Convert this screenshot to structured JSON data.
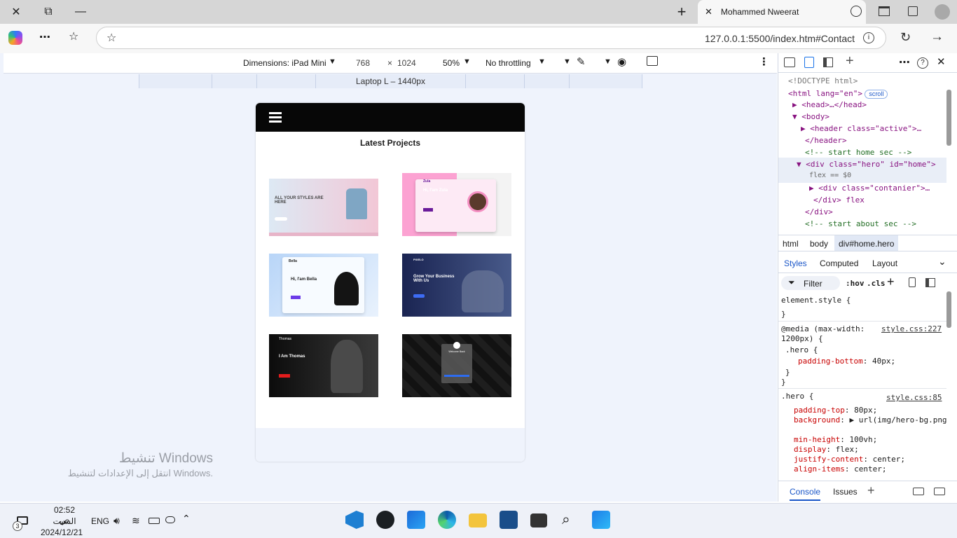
{
  "browser": {
    "tab_title": "Mohammed Nweerat",
    "url": "127.0.0.1:5500/index.htm#Contact",
    "icons": [
      "close-icon",
      "restore-icon",
      "minimize-icon",
      "plus-icon",
      "globe-icon",
      "tab-icon",
      "collections-icon",
      "profile-icon",
      "copilot-icon",
      "more-icon",
      "favorites-icon",
      "star-icon",
      "info-icon",
      "reload-icon",
      "forward-icon"
    ]
  },
  "device_toolbar": {
    "dimensions_label": "Dimensions: iPad Mini",
    "width": "768",
    "times": "×",
    "height": "1024",
    "zoom": "50%",
    "throttling": "No throttling"
  },
  "ruler": {
    "label": "Laptop L – 1440px"
  },
  "site": {
    "section_title": "Latest Projects",
    "projects": [
      {
        "heading": "ALL YOUR STYLES ARE HERE",
        "theme": "#d8e6f2"
      },
      {
        "heading": "Hi, I'am Zula",
        "brand": "Zula",
        "theme": "#fbb6dc"
      },
      {
        "heading": "Hi, I'am Bella",
        "brand": "Bella",
        "theme": "#cfe6fa"
      },
      {
        "heading": "Grow Your Business With Us",
        "brand": "PIXELO",
        "theme": "#1e2a5a"
      },
      {
        "heading": "I Am Thomas",
        "brand": "Thomas",
        "theme": "#1a1a1a"
      },
      {
        "heading": "Welcome Back",
        "theme": "#0e0e0e"
      }
    ]
  },
  "devtools": {
    "dom_lines": [
      {
        "t": "<!DOCTYPE html>"
      },
      {
        "t": "<html lang=\"en\">",
        "pill": "scroll"
      },
      {
        "t": "▶ <head>…</head>"
      },
      {
        "t": "▼ <body>"
      },
      {
        "t": "▶ <header class=\"active\">…"
      },
      {
        "t": "</header>"
      },
      {
        "t": "<!-- start home sec -->"
      },
      {
        "t": "▼ <div class=\"hero\" id=\"home\">"
      },
      {
        "t": "flex == $0"
      },
      {
        "t": "▶ <div class=\"contanier\">…"
      },
      {
        "t": "</div> flex"
      },
      {
        "t": "</div>"
      },
      {
        "t": "<!-- start about sec -->"
      }
    ],
    "breadcrumbs": [
      "html",
      "body",
      "div#home.hero"
    ],
    "styles_tabs": [
      "Styles",
      "Computed",
      "Layout"
    ],
    "filter_placeholder": "Filter",
    "hov": ":hov",
    "cls": ".cls",
    "rules": [
      {
        "selector": "element.style {",
        "close": "}",
        "props": []
      },
      {
        "selector": "@media (max-width: 1200px) {",
        "source": "style.css:227",
        "inner": ".hero {",
        "props": [
          {
            "k": "padding-bottom",
            "v": "40px;"
          }
        ],
        "close": "}"
      },
      {
        "selector": ".hero {",
        "source": "style.css:85",
        "props": [
          {
            "k": "padding-top",
            "v": "80px;"
          },
          {
            "k": "background",
            "v": "▶ url(img/hero-bg.png);"
          },
          {
            "k": "min-height",
            "v": "100vh;"
          },
          {
            "k": "display",
            "v": "flex;"
          },
          {
            "k": "justify-content",
            "v": "center;"
          },
          {
            "k": "align-items",
            "v": "center;"
          }
        ]
      }
    ],
    "drawer_tabs": [
      "Console",
      "Issues"
    ]
  },
  "watermark": {
    "line1": "تنشيط Windows",
    "line2": "انتقل إلى الإعدادات لتنشيط Windows."
  },
  "taskbar": {
    "time": "02:52 ص",
    "day": "السبت",
    "date": "2024/12/21",
    "lang": "ENG",
    "notif_count": "3"
  }
}
